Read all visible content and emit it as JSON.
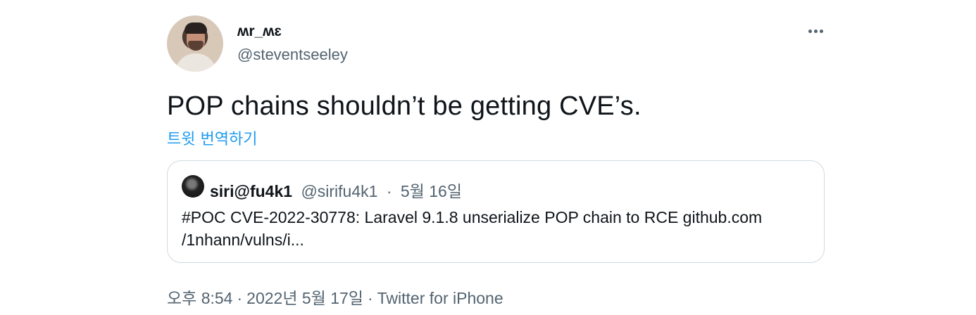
{
  "author": {
    "display_name": "ʍr_ʍɛ",
    "handle": "@steventseeley"
  },
  "tweet": {
    "text": "POP chains shouldn’t be getting CVE’s.",
    "translate_label": "트윗 번역하기"
  },
  "quoted": {
    "name": "siri@fu4k1",
    "handle": "@sirifu4k1",
    "separator": "·",
    "date": "5월 16일",
    "text_line1": "#POC CVE-2022-30778: Laravel 9.1.8 unserialize POP chain to RCE  github.com",
    "text_line2": "/1nhann/vulns/i..."
  },
  "meta": {
    "time": "오후 8:54",
    "sep1": "·",
    "date": "2022년 5월 17일",
    "sep2": "·",
    "source": "Twitter for iPhone"
  },
  "icons": {
    "more": "more-horizontal-icon"
  }
}
